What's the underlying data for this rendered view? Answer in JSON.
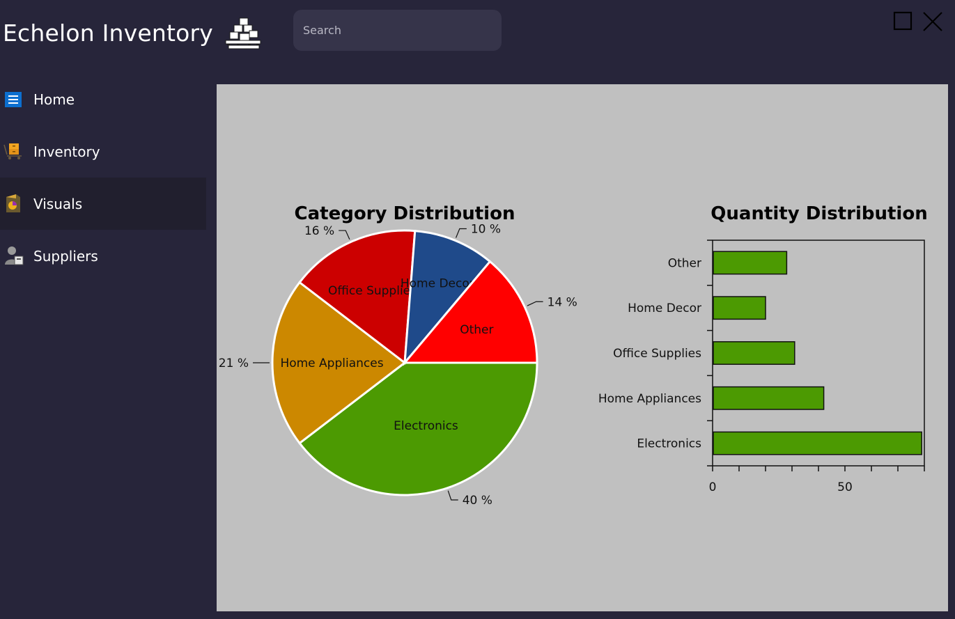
{
  "app": {
    "title": "Echelon Inventory"
  },
  "search": {
    "placeholder": "Search"
  },
  "sidebar": {
    "items": [
      {
        "label": "Home",
        "icon": "menu-icon"
      },
      {
        "label": "Inventory",
        "icon": "inventory-cart-icon"
      },
      {
        "label": "Visuals",
        "icon": "visuals-chart-icon",
        "active": true
      },
      {
        "label": "Suppliers",
        "icon": "supplier-icon"
      }
    ]
  },
  "colors": {
    "window_bg": "#27253a",
    "active_nav": "#211f2e",
    "panel_bg": "#c0c0c0",
    "bar_fill": "#4c9a02"
  },
  "chart_data": [
    {
      "type": "pie",
      "title": "Category Distribution",
      "categories": [
        "Electronics",
        "Home Appliances",
        "Office Supplies",
        "Home Decor",
        "Other"
      ],
      "values": [
        40,
        21,
        16,
        10,
        14
      ],
      "labels": [
        "40 %",
        "21 %",
        "16 %",
        "10 %",
        "14 %"
      ],
      "colors": [
        "#4c9a02",
        "#cc8800",
        "#cc0000",
        "#1f4a8a",
        "#ff0000"
      ]
    },
    {
      "type": "bar",
      "orientation": "horizontal",
      "title": "Quantity Distribution",
      "categories": [
        "Electronics",
        "Home Appliances",
        "Office Supplies",
        "Home Decor",
        "Other"
      ],
      "values": [
        79,
        42,
        31,
        20,
        28
      ],
      "xlim": [
        0,
        80
      ],
      "xticks": [
        0,
        50
      ],
      "color": "#4c9a02"
    }
  ]
}
